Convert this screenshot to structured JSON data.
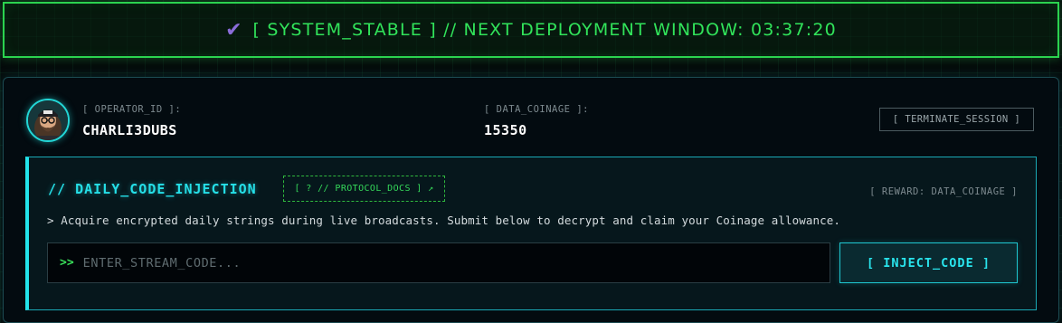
{
  "status_banner": {
    "icon": "checkmark-icon",
    "text": "[ SYSTEM_STABLE ] // NEXT DEPLOYMENT WINDOW: 03:37:20",
    "color": "#31e35a",
    "icon_color": "#8a6cd8"
  },
  "operator": {
    "avatar": "operator-avatar",
    "id_label": "[ OPERATOR_ID ]:",
    "id_value": "CHARLI3DUBS",
    "coinage_label": "[ DATA_COINAGE ]:",
    "coinage_value": "15350",
    "terminate_label": "[ TERMINATE_SESSION ]"
  },
  "daily_injection": {
    "title": "// DAILY_CODE_INJECTION",
    "docs_link": "[ ? // PROTOCOL_DOCS ] ↗",
    "reward": "[ REWARD: DATA_COINAGE ]",
    "description": "> Acquire encrypted daily strings during live broadcasts. Submit below to decrypt and claim your Coinage allowance.",
    "input_prompt": ">>",
    "input_placeholder": "ENTER_STREAM_CODE...",
    "input_value": "",
    "submit_label": "[ INJECT_CODE ]",
    "accent_color": "#25dfe7"
  }
}
